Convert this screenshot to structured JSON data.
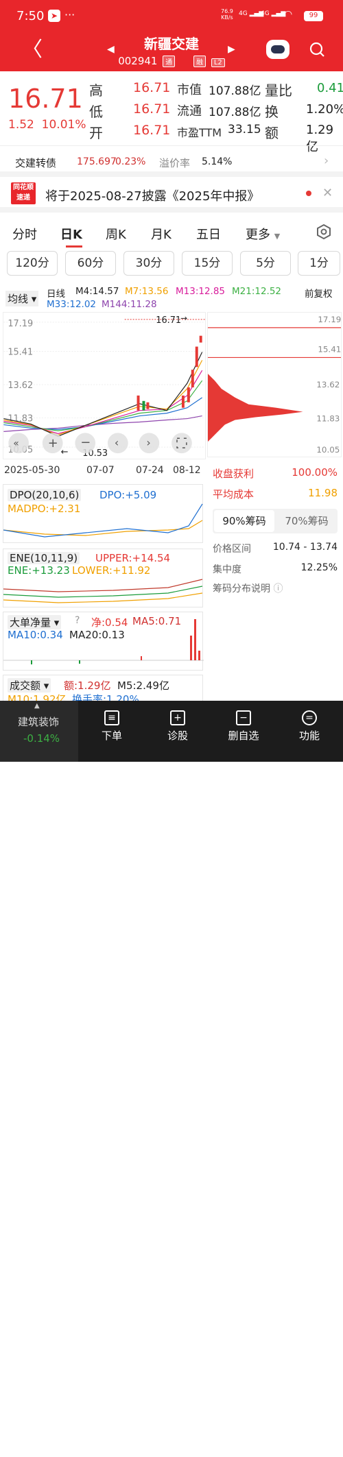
{
  "status": {
    "time": "7:50",
    "dots": "···",
    "net_speed": "76.9",
    "net_unit": "KB/s",
    "sig1": "4G",
    "sig2": "4G",
    "battery": "99"
  },
  "header": {
    "title": "新疆交建",
    "code": "002941",
    "tag1": "通",
    "tag2": "融",
    "tag3": "L2"
  },
  "quote": {
    "price": "16.71",
    "change": "1.52",
    "change_pct": "10.01%",
    "high_label": "高",
    "high": "16.71",
    "low_label": "低",
    "low": "16.71",
    "open_label": "开",
    "open": "16.71",
    "mcap_label": "市值",
    "mcap": "107.88亿",
    "float_label": "流通",
    "float": "107.88亿",
    "pe_label": "市盈TTM",
    "pe": "33.15",
    "vr_label": "量比",
    "vr": "0.41",
    "turn_label": "换",
    "turn": "1.20%",
    "amt_label": "额",
    "amt": "1.29亿"
  },
  "bond": {
    "name": "交建转债",
    "price": "175.697",
    "pct": "0.23%",
    "premium_label": "溢价率",
    "premium": "5.14%"
  },
  "notice": {
    "logo_top": "同花顺",
    "logo_bottom": "速递",
    "text": "将于2025-08-27披露《2025年中报》"
  },
  "tabs": [
    "分时",
    "日K",
    "周K",
    "月K",
    "五日",
    "更多"
  ],
  "periods": [
    "120分",
    "60分",
    "30分",
    "15分",
    "5分",
    "1分"
  ],
  "ma": {
    "label": "均线",
    "type": "日线",
    "m4": "M4:14.57",
    "m7": "M7:13.56",
    "m13": "M13:12.85",
    "m21": "M21:12.52",
    "m33": "M33:12.02",
    "m144": "M144:11.28",
    "adj": "前复权"
  },
  "main_chart": {
    "top_price": "17.19",
    "high_mark": "16.71",
    "low_mark": "10.53",
    "bottom_price": "10.05",
    "left_price1": "15.41",
    "left_price2": "13.62",
    "left_price3": "11.83",
    "dates": [
      "2025-05-30",
      "07-07",
      "07-24",
      "08-12"
    ]
  },
  "chip_axis": [
    "17.19",
    "15.41",
    "13.62",
    "11.83",
    "10.05"
  ],
  "dpo": {
    "name": "DPO(20,10,6)",
    "dpo": "DPO:+5.09",
    "madpo": "MADPO:+2.31"
  },
  "ene": {
    "name": "ENE(10,11,9)",
    "upper": "UPPER:+14.54",
    "ene": "ENE:+13.23",
    "lower": "LOWER:+11.92"
  },
  "bigorder": {
    "name": "大单净量",
    "net": "净:0.54",
    "ma5": "MA5:0.71",
    "ma10": "MA10:0.34",
    "ma20": "MA20:0.13"
  },
  "volume": {
    "name": "成交额",
    "amt": "额:1.29亿",
    "m5": "M5:2.49亿",
    "m10": "M10:1.92亿",
    "turn": "换手率:1.20%"
  },
  "chips": {
    "profit_label": "收盘获利",
    "profit": "100.00%",
    "cost_label": "平均成本",
    "cost": "11.98",
    "tab90": "90%筹码",
    "tab70": "70%筹码",
    "range_label": "价格区间",
    "range": "10.74 - 13.74",
    "conc_label": "集中度",
    "conc": "12.25%",
    "help": "筹码分布说明"
  },
  "bottom": {
    "sector": "建筑装饰",
    "sector_pct": "-0.14%",
    "items": [
      "下单",
      "诊股",
      "删自选",
      "功能"
    ]
  },
  "colors": {
    "up": "#e53935",
    "down": "#1a9b3a",
    "header": "#e8262b"
  }
}
